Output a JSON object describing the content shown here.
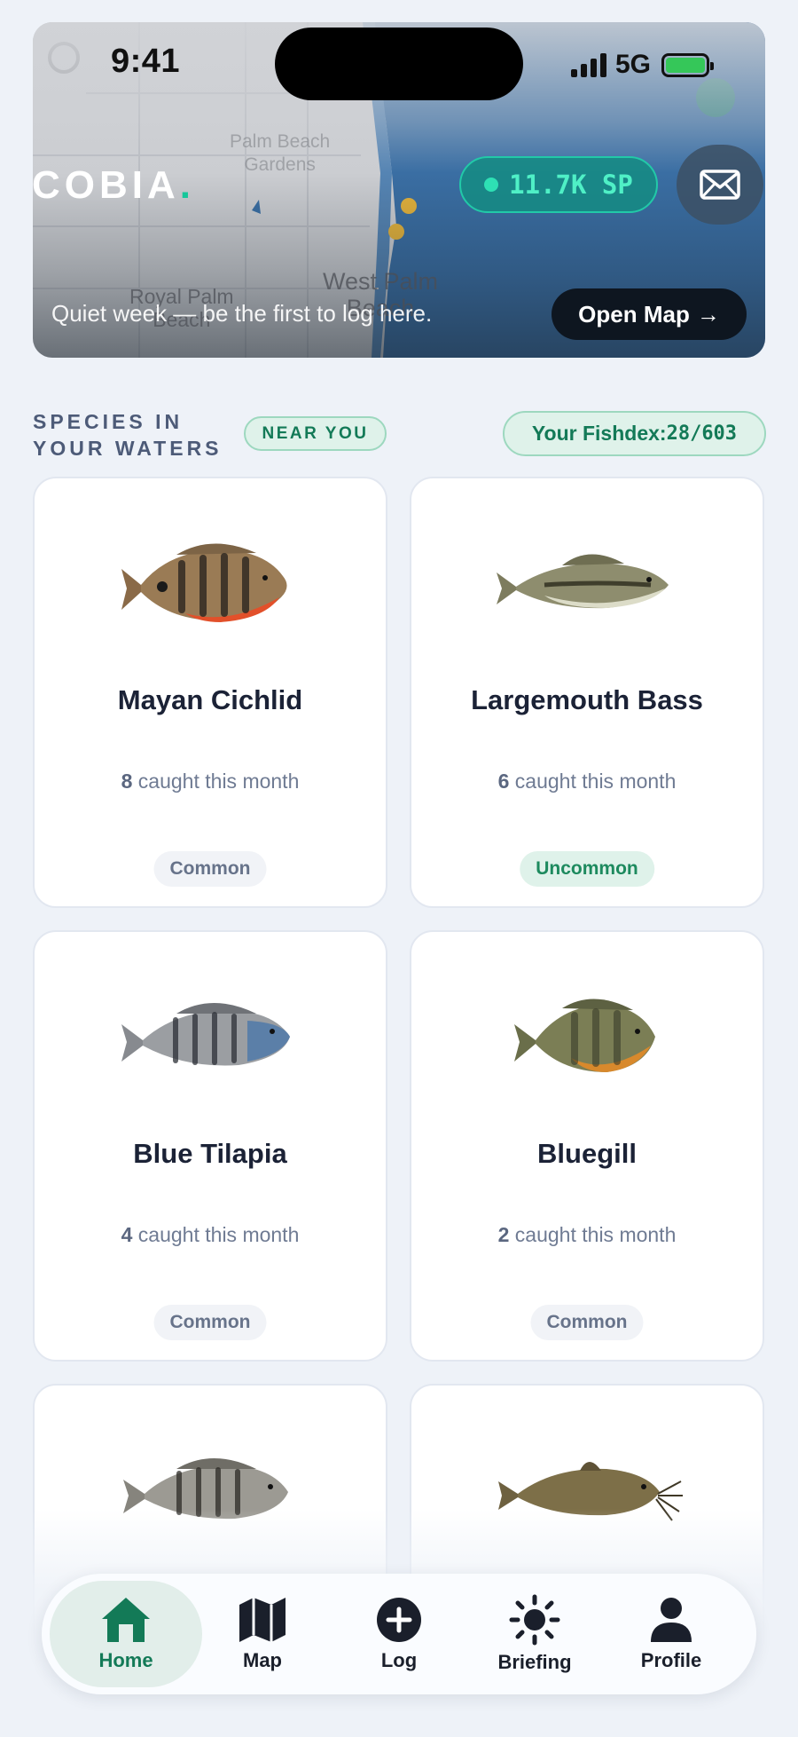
{
  "status_bar": {
    "time": "9:41",
    "network": "5G"
  },
  "header": {
    "logo": "COBIA",
    "logo_dot": ".",
    "points": "11.7K SP",
    "mail_icon": "envelope-icon"
  },
  "hero": {
    "map_labels": [
      "West Palm",
      "Beach",
      "Royal Palm",
      "Beach",
      "Palm Beach",
      "Gardens"
    ],
    "message": "Quiet week — be the first to log here.",
    "open_map_label": "Open Map",
    "open_map_arrow": "→"
  },
  "section": {
    "title_line1": "SPECIES IN",
    "title_line2": "YOUR WATERS",
    "badge": "NEAR YOU",
    "fishdex_label": "Your Fishdex: ",
    "fishdex_value": "28/603"
  },
  "species": [
    {
      "name": "Mayan Cichlid",
      "count": "8",
      "count_suffix": " caught this month",
      "rarity": "Common"
    },
    {
      "name": "Largemouth Bass",
      "count": "6",
      "count_suffix": " caught this month",
      "rarity": "Uncommon"
    },
    {
      "name": "Blue Tilapia",
      "count": "4",
      "count_suffix": " caught this month",
      "rarity": "Common"
    },
    {
      "name": "Bluegill",
      "count": "2",
      "count_suffix": " caught this month",
      "rarity": "Common"
    }
  ],
  "colors": {
    "accent": "#137a57",
    "brand_dot": "#16c79a",
    "points": "#4ff0c6"
  },
  "tabs": [
    {
      "label": "Home",
      "icon": "home-icon",
      "active": true
    },
    {
      "label": "Map",
      "icon": "map-icon",
      "active": false
    },
    {
      "label": "Log",
      "icon": "plus-circle-icon",
      "active": false
    },
    {
      "label": "Briefing",
      "icon": "sun-icon",
      "active": false
    },
    {
      "label": "Profile",
      "icon": "person-icon",
      "active": false
    }
  ]
}
